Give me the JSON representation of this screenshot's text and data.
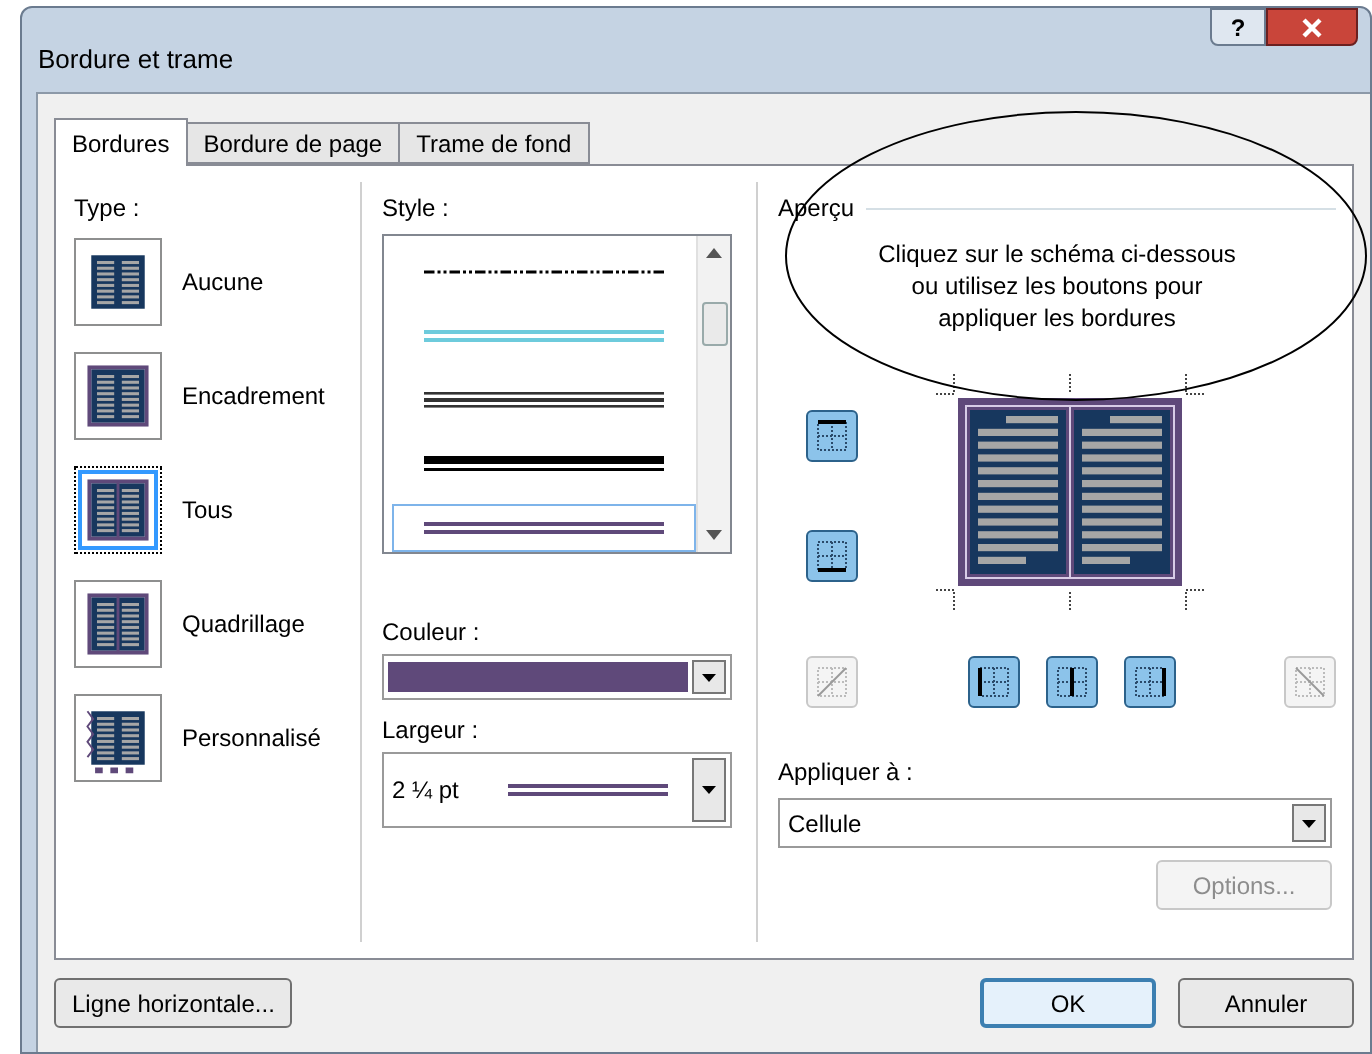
{
  "window": {
    "title": "Bordure et trame",
    "help_button": "?"
  },
  "tabs": [
    {
      "label": "Bordures",
      "selected": true
    },
    {
      "label": "Bordure de page",
      "selected": false
    },
    {
      "label": "Trame de fond",
      "selected": false
    }
  ],
  "type": {
    "label": "Type :",
    "items": [
      {
        "label": "Aucune",
        "kind": "none",
        "selected": false
      },
      {
        "label": "Encadrement",
        "kind": "box",
        "selected": false
      },
      {
        "label": "Tous",
        "kind": "all",
        "selected": true
      },
      {
        "label": "Quadrillage",
        "kind": "grid",
        "selected": false
      },
      {
        "label": "Personnalisé",
        "kind": "custom",
        "selected": false
      }
    ]
  },
  "style": {
    "label": "Style :",
    "items": [
      {
        "kind": "dashdotdot",
        "color": "#000000",
        "selected": false
      },
      {
        "kind": "double",
        "color": "#6ecbdc",
        "selected": false
      },
      {
        "kind": "triple",
        "color": "#333333",
        "selected": false
      },
      {
        "kind": "thickthin",
        "color": "#000000",
        "selected": false
      },
      {
        "kind": "double",
        "color": "#5f497a",
        "selected": true
      }
    ]
  },
  "couleur": {
    "label": "Couleur :",
    "color": "#5f497a"
  },
  "largeur": {
    "label": "Largeur :",
    "value": "2 ¼ pt"
  },
  "apercu": {
    "label": "Aperçu",
    "instructions": "Cliquez sur le schéma ci-dessous ou utilisez les boutons pour appliquer les bordures",
    "side_buttons": [
      {
        "kind": "top",
        "disabled": false
      },
      {
        "kind": "bottom",
        "disabled": false
      }
    ],
    "bottom_buttons": [
      {
        "kind": "diagup",
        "disabled": true
      },
      {
        "kind": "left",
        "disabled": false
      },
      {
        "kind": "inner",
        "disabled": false
      },
      {
        "kind": "right",
        "disabled": false
      },
      {
        "kind": "diagdown",
        "disabled": true
      }
    ]
  },
  "appliquer": {
    "label": "Appliquer à :",
    "value": "Cellule"
  },
  "options_button": {
    "label": "Options...",
    "disabled": true
  },
  "footer": {
    "left_button": "Ligne horizontale...",
    "buttons": [
      {
        "label": "OK",
        "default": true
      },
      {
        "label": "Annuler",
        "default": false
      }
    ]
  }
}
